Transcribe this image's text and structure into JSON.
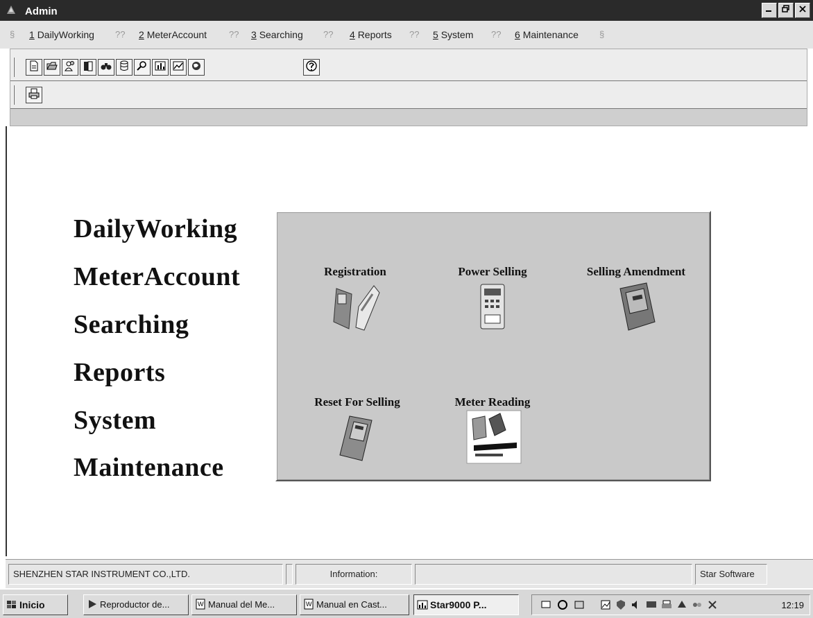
{
  "window": {
    "title": "Admin"
  },
  "menu": {
    "separator": "??",
    "items": [
      {
        "num": "1",
        "label": "DailyWorking"
      },
      {
        "num": "2",
        "label": "MeterAccount"
      },
      {
        "num": "3",
        "label": "Searching"
      },
      {
        "num": "4",
        "label": "Reports"
      },
      {
        "num": "5",
        "label": "System"
      },
      {
        "num": "6",
        "label": "Maintenance"
      }
    ],
    "edge_glyph": "§"
  },
  "toolbar": {
    "row1_icons": [
      "new-icon",
      "open-icon",
      "users-icon",
      "book-icon",
      "binoculars-icon",
      "database-icon",
      "zoom-icon",
      "chart-icon",
      "graph-icon",
      "globe-icon"
    ],
    "row1_extra_icon": "help-icon",
    "row2_icons": [
      "print-icon"
    ]
  },
  "module_labels": [
    "DailyWorking",
    "MeterAccount",
    "Searching",
    "Reports",
    "System",
    "Maintenance"
  ],
  "tiles": [
    {
      "label": "Registration",
      "icon": "meter-card-icon"
    },
    {
      "label": "Power Selling",
      "icon": "meter-keypad-icon"
    },
    {
      "label": "Selling Amendment",
      "icon": "meter-box-icon"
    },
    {
      "label": "Reset For Selling",
      "icon": "meter-reset-icon"
    },
    {
      "label": "Meter Reading",
      "icon": "meter-reading-icon"
    }
  ],
  "statusbar": {
    "company": "SHENZHEN STAR INSTRUMENT CO.,LTD.",
    "information_label": "Information:",
    "information_value": "",
    "brand": "Star Software"
  },
  "taskbar": {
    "start_label": "Inicio",
    "tasks": [
      {
        "label": "Reproductor de..."
      },
      {
        "label": "Manual del Me..."
      },
      {
        "label": "Manual en Cast..."
      },
      {
        "label": "Star9000  P..."
      }
    ],
    "clock": "12:19"
  }
}
